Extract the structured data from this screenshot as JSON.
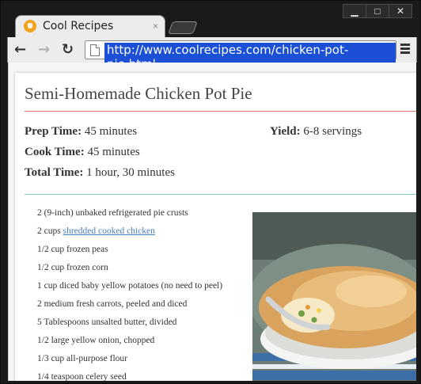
{
  "browser": {
    "tab_title": "Cool Recipes",
    "tab_close": "×",
    "url": "http://www.coolrecipes.com/chicken-pot-pie.html",
    "controls": {
      "minimize": "▁",
      "maximize": "□",
      "close": "✕"
    },
    "nav": {
      "back": "←",
      "forward": "→",
      "reload": "↻"
    }
  },
  "recipe": {
    "title": "Semi-Homemade Chicken Pot Pie",
    "prep_label": "Prep Time:",
    "prep_value": "45 minutes",
    "yield_label": "Yield:",
    "yield_value": "6-8 servings",
    "cook_label": "Cook Time:",
    "cook_value": "45 minutes",
    "total_label": "Total Time:",
    "total_value": "1 hour, 30 minutes",
    "ingredients": [
      "2 (9-inch) unbaked refrigerated pie crusts",
      "1/2 cup frozen peas",
      "1/2 cup frozen corn",
      "1 cup diced baby yellow potatoes (no need to peel)",
      "2 medium fresh carrots, peeled and diced",
      "5 Tablespoons unsalted butter, divided",
      "1/2 large yellow onion, chopped",
      "1/3 cup all-purpose flour",
      "1/4 teaspoon celery seed"
    ],
    "ingredient_link_prefix": "2 cups ",
    "ingredient_link_text": "shredded cooked chicken"
  },
  "colors": {
    "accent_rule": "#e07070",
    "section_rule": "#8ecbd9",
    "link": "#4a7fc1",
    "url_highlight": "#1a4fd6"
  }
}
